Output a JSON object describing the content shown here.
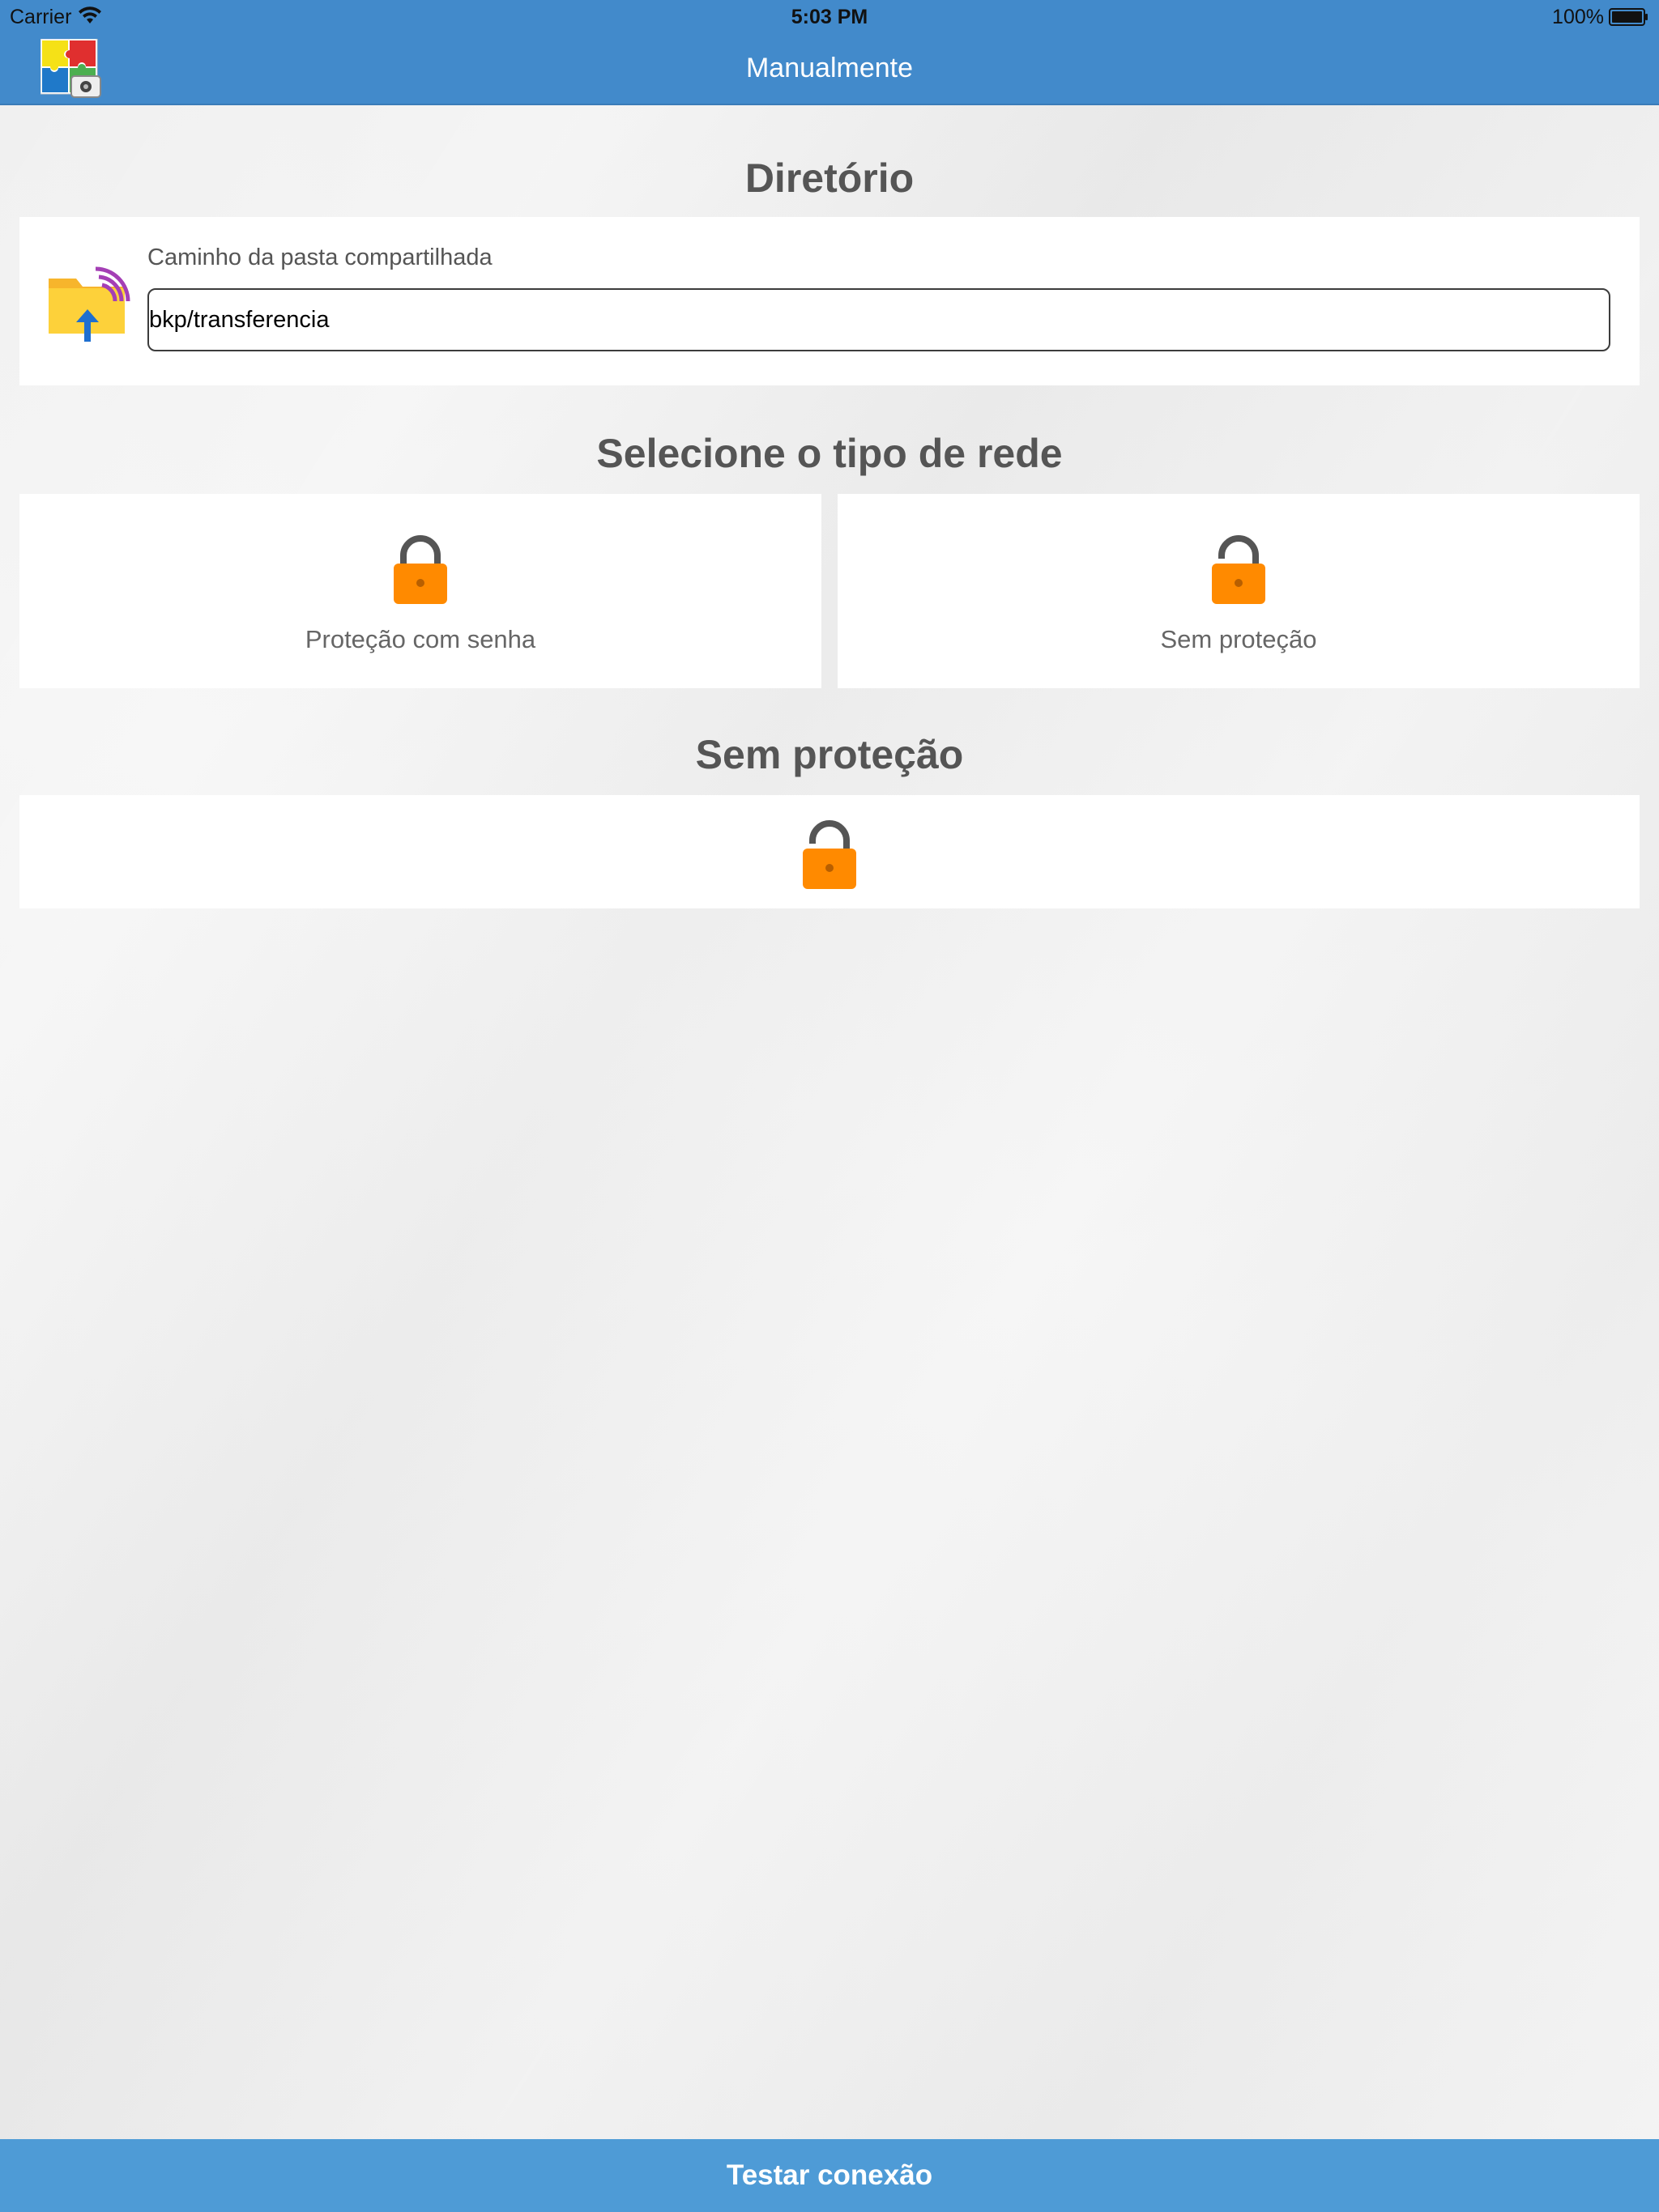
{
  "status_bar": {
    "carrier": "Carrier",
    "time": "5:03 PM",
    "battery": "100%"
  },
  "nav": {
    "title": "Manualmente"
  },
  "directory": {
    "heading": "Diretório",
    "field_label": "Caminho da pasta compartilhada",
    "path_value": "bkp/transferencia"
  },
  "network_type": {
    "heading": "Selecione o tipo de rede",
    "options": [
      {
        "label": "Proteção com senha",
        "icon": "lock-closed-icon"
      },
      {
        "label": "Sem proteção",
        "icon": "lock-open-icon"
      }
    ]
  },
  "selected": {
    "heading": "Sem proteção",
    "icon": "lock-open-icon"
  },
  "footer": {
    "button_label": "Testar conexão"
  },
  "colors": {
    "nav_bar": "#428acb",
    "footer_bar": "#4e9bd6",
    "lock_orange": "#ff8a00",
    "lock_shackle": "#555555",
    "heading_text": "#555555"
  }
}
